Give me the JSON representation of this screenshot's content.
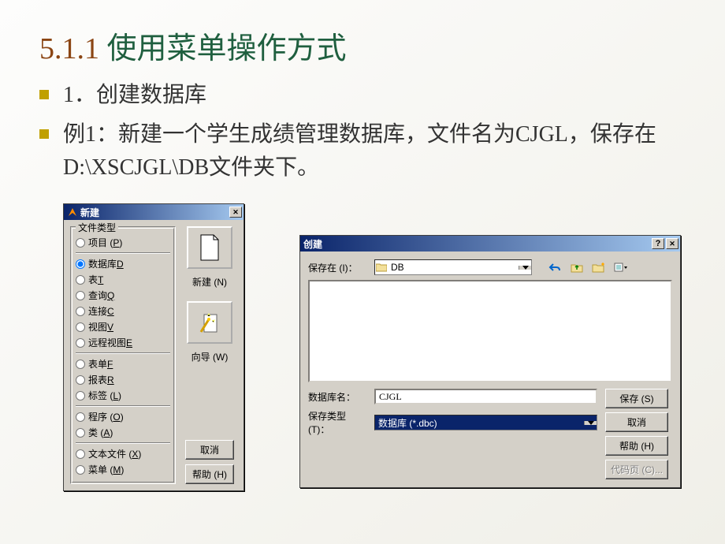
{
  "slide": {
    "title_num": "5.1.1",
    "title_text": "使用菜单操作方式",
    "bullet1": "1．创建数据库",
    "bullet2": "例1：新建一个学生成绩管理数据库，文件名为CJGL，保存在D:\\XSCJGL\\DB文件夹下。"
  },
  "new_dialog": {
    "title": "新建",
    "filetype_label": "文件类型",
    "radios": [
      "项目 (P)",
      "数据库D",
      "表T",
      "查询Q",
      "连接C",
      "视图V",
      "远程视图E",
      "表单F",
      "报表R",
      "标签 (L)",
      "程序 (O)",
      "类 (A)",
      "文本文件 (X)",
      "菜单 (M)"
    ],
    "selected_index": 1,
    "btn_new": "新建 (N)",
    "btn_wizard": "向导 (W)",
    "btn_cancel": "取消",
    "btn_help": "帮助 (H)"
  },
  "save_dialog": {
    "title": "创建",
    "save_in_label": "保存在 (I)：",
    "folder": "DB",
    "name_label": "数据库名：",
    "name_value": "CJGL",
    "type_label": "保存类型 (T)：",
    "type_value": "数据库 (*.dbc)",
    "btn_save": "保存 (S)",
    "btn_cancel": "取消",
    "btn_help": "帮助 (H)",
    "btn_codepage": "代码页 (C)..."
  }
}
